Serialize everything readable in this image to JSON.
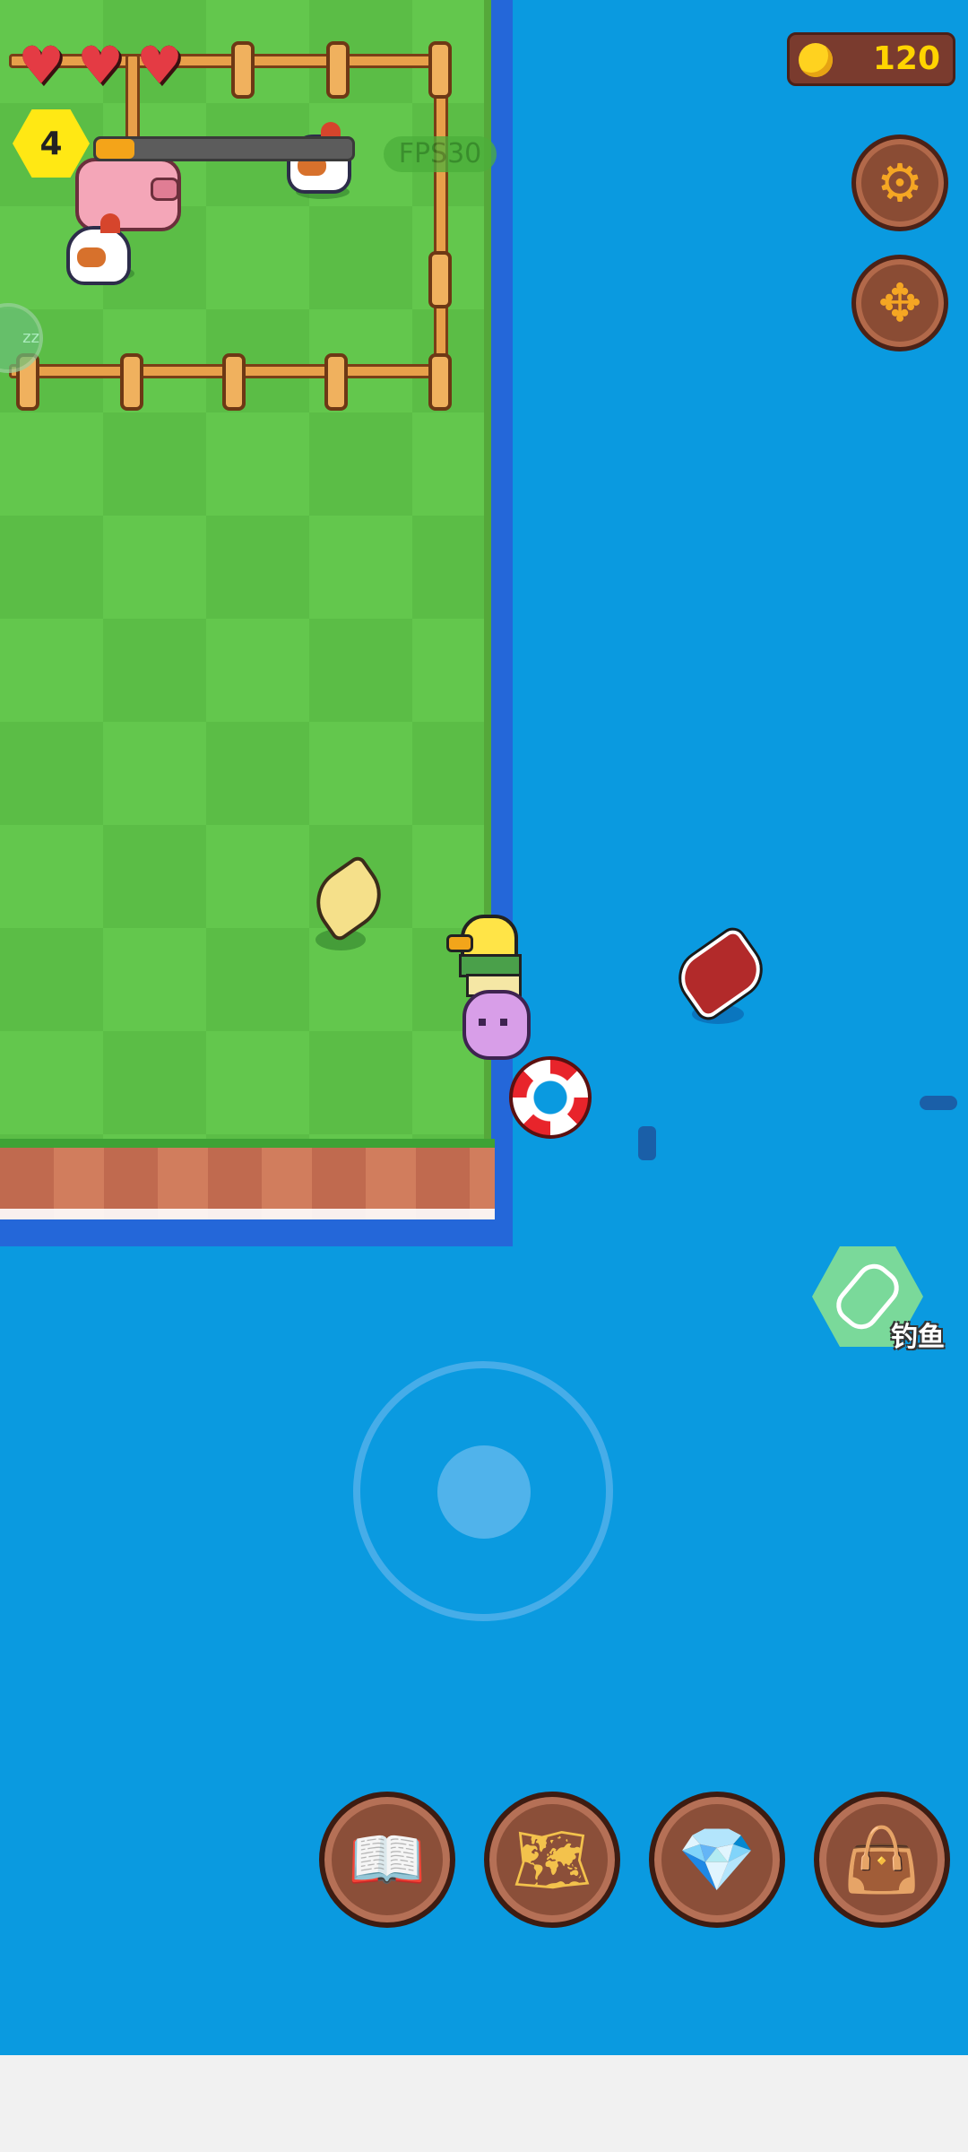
{
  "hud": {
    "hearts": 3,
    "level": "4",
    "xp_progress": 0.15,
    "fps_label": "FPS30",
    "sleep_label": "zz"
  },
  "currency": {
    "coins": "120"
  },
  "buttons": {
    "settings_icon": "gear-icon",
    "move_icon": "move-arrows-icon",
    "fishing_label": "钓鱼"
  },
  "menu": [
    {
      "name": "book",
      "icon": "book-icon"
    },
    {
      "name": "map",
      "icon": "scroll-map-icon"
    },
    {
      "name": "shop",
      "icon": "gem-coin-icon"
    },
    {
      "name": "bag",
      "icon": "leather-bag-icon"
    }
  ],
  "colors": {
    "water": "#0a9ae0",
    "grass": "#63c74d",
    "coin_text": "#ffd400",
    "xp_fill": "#f4a419",
    "level_badge": "#ffe814",
    "fishing_button": "#7ad99a"
  }
}
